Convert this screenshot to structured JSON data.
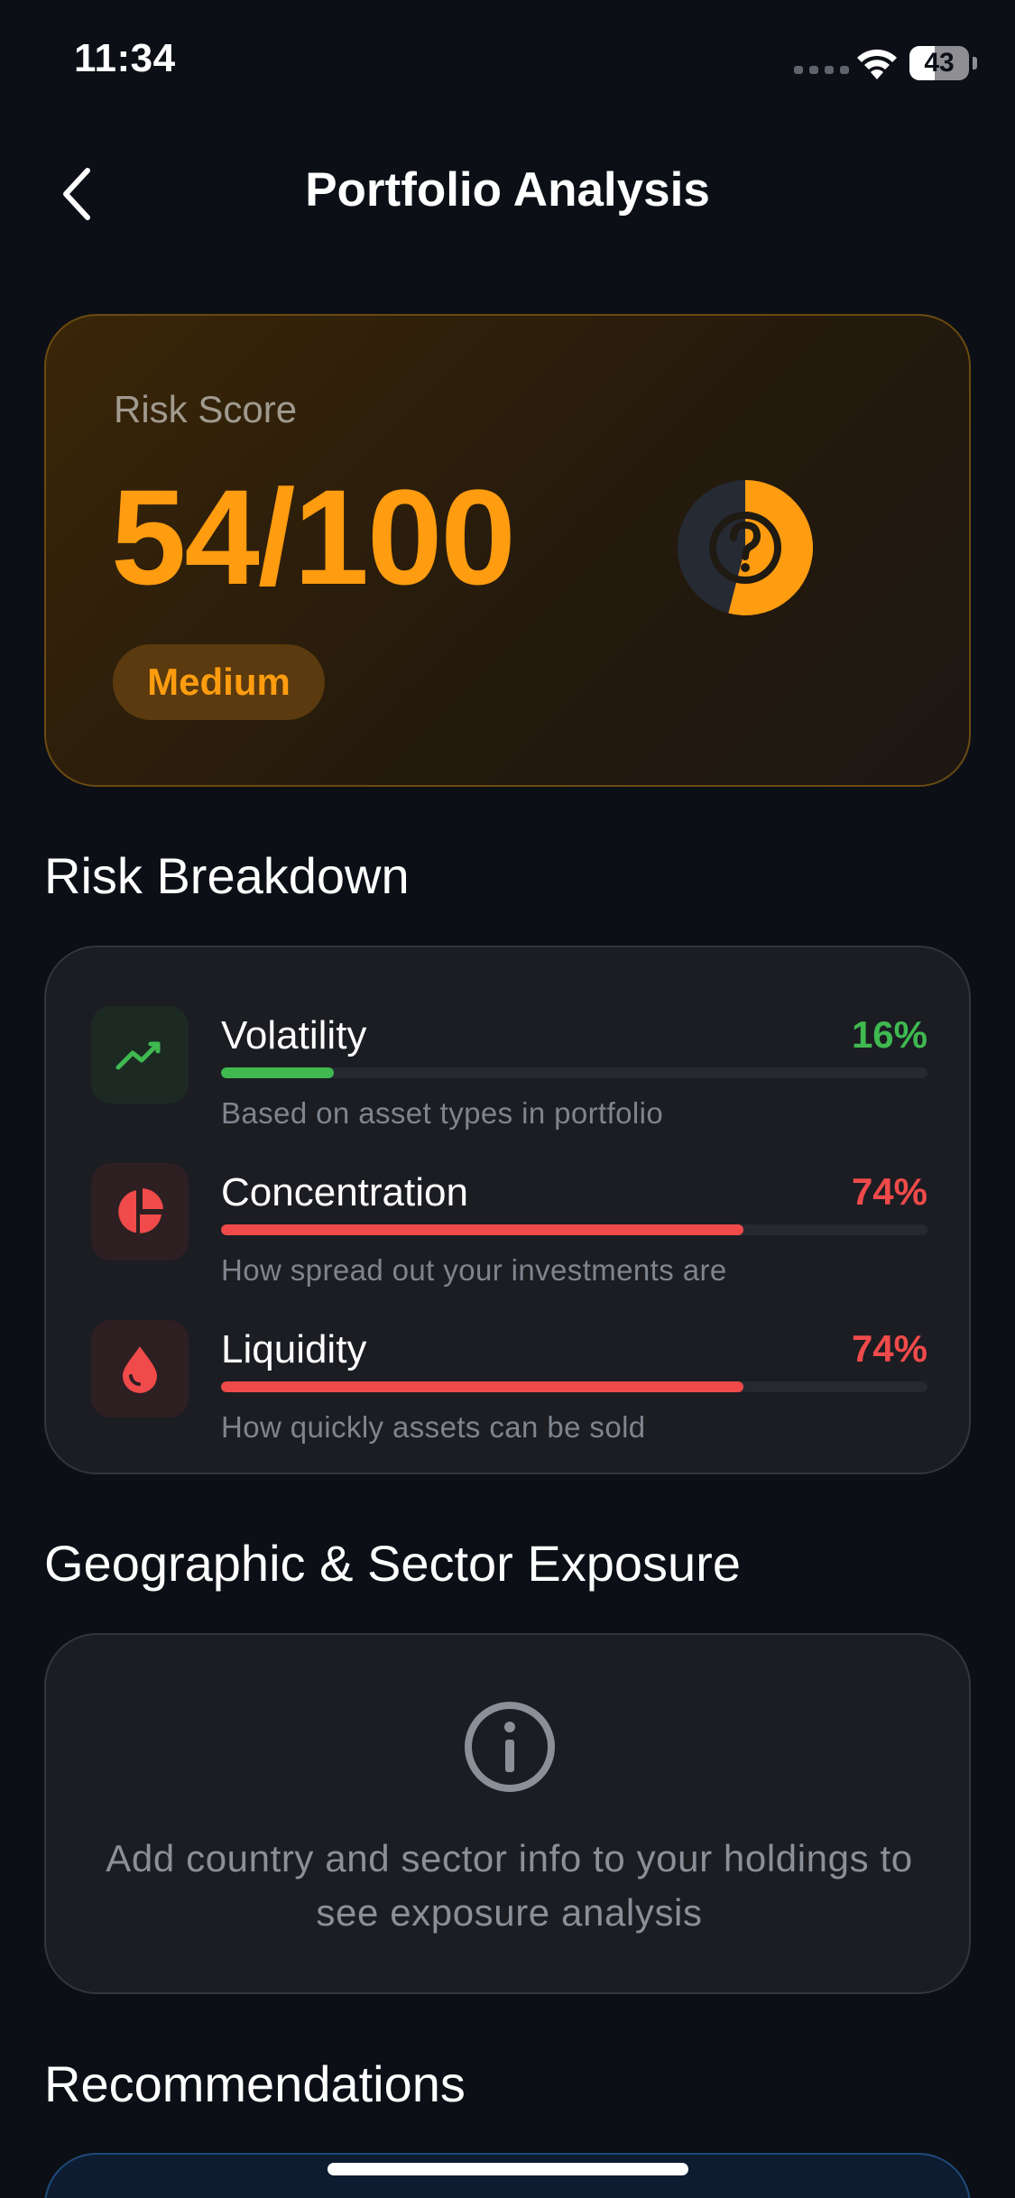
{
  "status_bar": {
    "time": "11:34",
    "battery": "43",
    "battery_level": 0.43
  },
  "nav": {
    "title": "Portfolio Analysis",
    "back_icon": "chevron-left-icon"
  },
  "risk_score": {
    "label": "Risk Score",
    "value": "54/100",
    "score": 54,
    "max": 100,
    "level": "Medium",
    "icon": "question-icon",
    "accent": "#ff9c10"
  },
  "risk_breakdown": {
    "title": "Risk Breakdown",
    "items": [
      {
        "name": "Volatility",
        "percent": "16%",
        "value": 16,
        "description": "Based on asset types in portfolio",
        "icon": "trending-up-icon",
        "color": "#3fb950",
        "icon_bg": "#1d2a24"
      },
      {
        "name": "Concentration",
        "percent": "74%",
        "value": 74,
        "description": "How spread out your investments are",
        "icon": "pie-chart-icon",
        "color": "#f04a4a",
        "icon_bg": "#2e1f22"
      },
      {
        "name": "Liquidity",
        "percent": "74%",
        "value": 74,
        "description": "How quickly assets can be sold",
        "icon": "water-drop-icon",
        "color": "#f04a4a",
        "icon_bg": "#2e1f22"
      }
    ]
  },
  "exposure": {
    "title": "Geographic & Sector Exposure",
    "icon": "info-icon",
    "message": "Add country and sector info to your holdings to see exposure analysis"
  },
  "recommendations": {
    "title": "Recommendations"
  }
}
